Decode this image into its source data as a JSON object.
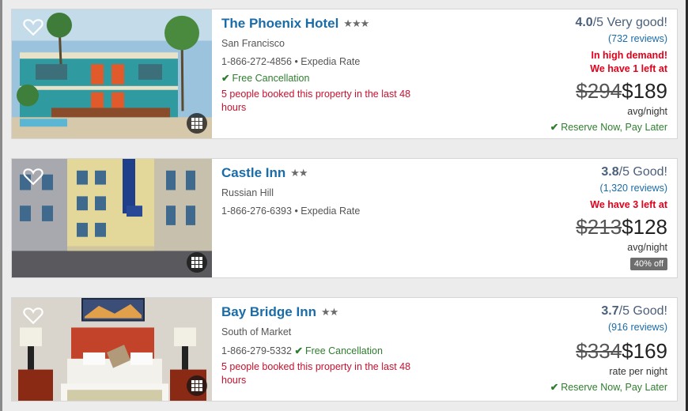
{
  "colors": {
    "link": "#1a6ca8",
    "alert": "#e2001a",
    "booked": "#c8102e",
    "green": "#2f7d2f"
  },
  "hotels": [
    {
      "name": "The Phoenix Hotel",
      "stars": "★★★",
      "location": "San Francisco",
      "phone": "1-866-272-4856",
      "rate_note": "Expedia Rate",
      "free_cancellation": "Free Cancellation",
      "booked_note": "5 people booked this property in the last 48 hours",
      "rating_score": "4.0",
      "rating_suffix": "/5 Very good!",
      "reviews": "(732 reviews)",
      "demand": "In high demand!",
      "left": "We have 1 left at",
      "old_price": "$294",
      "new_price": "$189",
      "unit": "avg/night",
      "reserve": "Reserve Now, Pay Later"
    },
    {
      "name": "Castle Inn",
      "stars": "★★",
      "location": "Russian Hill",
      "phone": "1-866-276-6393",
      "rate_note": "Expedia Rate",
      "rating_score": "3.8",
      "rating_suffix": "/5 Good!",
      "reviews": "(1,320 reviews)",
      "left": "We have 3 left at",
      "old_price": "$213",
      "new_price": "$128",
      "unit": "avg/night",
      "discount": "40% off"
    },
    {
      "name": "Bay Bridge Inn",
      "stars": "★★",
      "location": "South of Market",
      "phone": "1-866-279-5332",
      "free_cancellation": "Free Cancellation",
      "booked_note": "5 people booked this property in the last 48 hours",
      "rating_score": "3.7",
      "rating_suffix": "/5 Good!",
      "reviews": "(916 reviews)",
      "old_price": "$334",
      "new_price": "$169",
      "unit": "rate per night",
      "reserve": "Reserve Now, Pay Later"
    }
  ]
}
